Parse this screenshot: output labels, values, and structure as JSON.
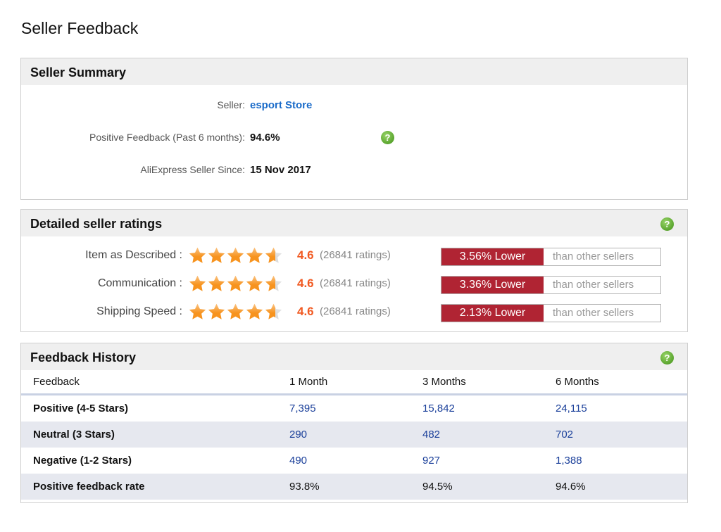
{
  "page_title": "Seller Feedback",
  "summary": {
    "title": "Seller Summary",
    "seller_label": "Seller:",
    "seller_name": "esport Store",
    "positive_label": "Positive Feedback (Past 6 months):",
    "positive_value": "94.6%",
    "since_label": "AliExpress Seller Since:",
    "since_value": "15 Nov 2017",
    "help_icon": "?"
  },
  "ratings": {
    "title": "Detailed seller ratings",
    "help_icon": "?",
    "colors": {
      "score": "#f15a22",
      "lower_bar": "#b02433",
      "star": "#f7931e"
    },
    "rows": [
      {
        "label": "Item as Described :",
        "score": "4.6",
        "stars": 4.6,
        "count": "(26841 ratings)",
        "compare": "3.56% Lower",
        "compare_suffix": "than other sellers"
      },
      {
        "label": "Communication :",
        "score": "4.6",
        "stars": 4.6,
        "count": "(26841 ratings)",
        "compare": "3.36% Lower",
        "compare_suffix": "than other sellers"
      },
      {
        "label": "Shipping Speed :",
        "score": "4.6",
        "stars": 4.6,
        "count": "(26841 ratings)",
        "compare": "2.13% Lower",
        "compare_suffix": "than other sellers"
      }
    ]
  },
  "history": {
    "title": "Feedback History",
    "help_icon": "?",
    "columns": [
      "Feedback",
      "1 Month",
      "3 Months",
      "6 Months"
    ],
    "rows": [
      {
        "label": "Positive (4-5 Stars)",
        "values": [
          "7,395",
          "15,842",
          "24,115"
        ]
      },
      {
        "label": "Neutral (3 Stars)",
        "values": [
          "290",
          "482",
          "702"
        ]
      },
      {
        "label": "Negative (1-2 Stars)",
        "values": [
          "490",
          "927",
          "1,388"
        ]
      },
      {
        "label": "Positive feedback rate",
        "values": [
          "93.8%",
          "94.5%",
          "94.6%"
        ]
      }
    ]
  }
}
